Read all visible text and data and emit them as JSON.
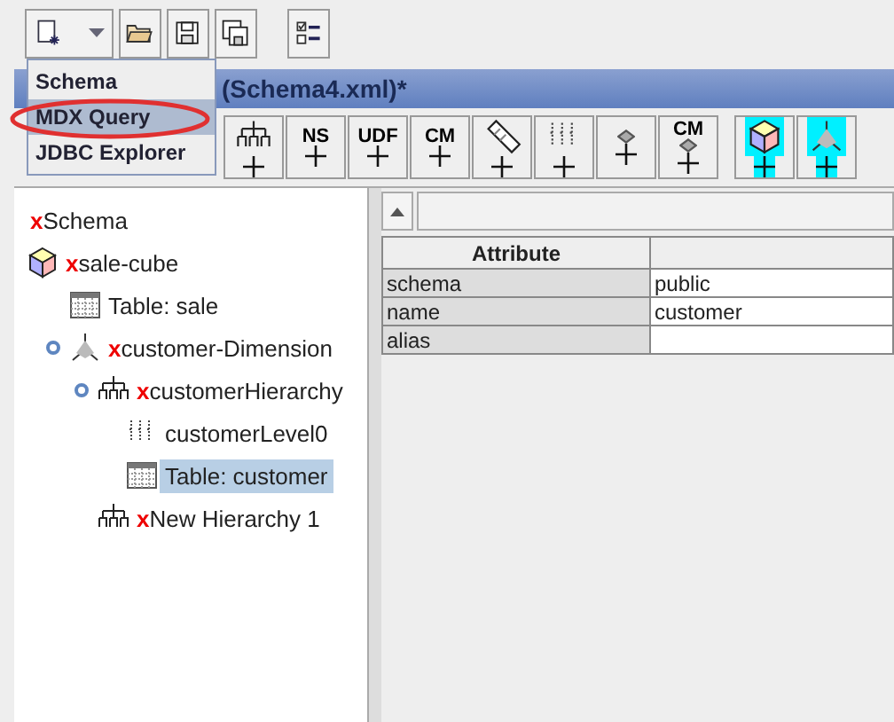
{
  "toolbar": [
    {
      "kind": "new"
    },
    {
      "kind": "open"
    },
    {
      "kind": "save"
    },
    {
      "kind": "save-as"
    },
    {
      "kind": "preferences"
    }
  ],
  "menu": {
    "items": [
      {
        "label": "Schema",
        "selected": false
      },
      {
        "label": "MDX Query",
        "selected": true
      },
      {
        "label": "JDBC Explorer",
        "selected": false
      }
    ]
  },
  "window": {
    "title": "(Schema4.xml)*"
  },
  "schema_toolbar": [
    {
      "kind": "hierarchy"
    },
    {
      "kind": "text",
      "label": "NS"
    },
    {
      "kind": "text",
      "label": "UDF"
    },
    {
      "kind": "text",
      "label": "CM"
    },
    {
      "kind": "eraser"
    },
    {
      "kind": "level"
    },
    {
      "kind": "shape"
    },
    {
      "kind": "text-shape",
      "label": "CM"
    },
    {
      "kind": "cube"
    },
    {
      "kind": "dimension"
    }
  ],
  "tree": [
    {
      "kind": "schema",
      "prefix": "x",
      "label": "Schema",
      "selected": false
    },
    {
      "kind": "cube",
      "prefix": "x",
      "label": "sale-cube",
      "selected": false,
      "children": [
        {
          "kind": "table",
          "label": "Table: sale",
          "selected": false
        },
        {
          "kind": "dimension",
          "prefix": "x",
          "label": "customer-Dimension",
          "selected": false,
          "expanded": true,
          "children": [
            {
              "kind": "hierarchy",
              "prefix": "x",
              "label": "customerHierarchy",
              "selected": false,
              "expanded": true,
              "children": [
                {
                  "kind": "level",
                  "label": "customerLevel0",
                  "selected": false
                },
                {
                  "kind": "table",
                  "label": "Table: customer",
                  "selected": true
                }
              ]
            },
            {
              "kind": "hierarchy",
              "prefix": "x",
              "label": "New Hierarchy 1",
              "selected": false
            }
          ]
        }
      ]
    }
  ],
  "table": {
    "columns": [
      "Attribute"
    ],
    "rows": [
      [
        "schema",
        "public"
      ],
      [
        "name",
        "customer"
      ],
      [
        "alias",
        ""
      ]
    ]
  }
}
